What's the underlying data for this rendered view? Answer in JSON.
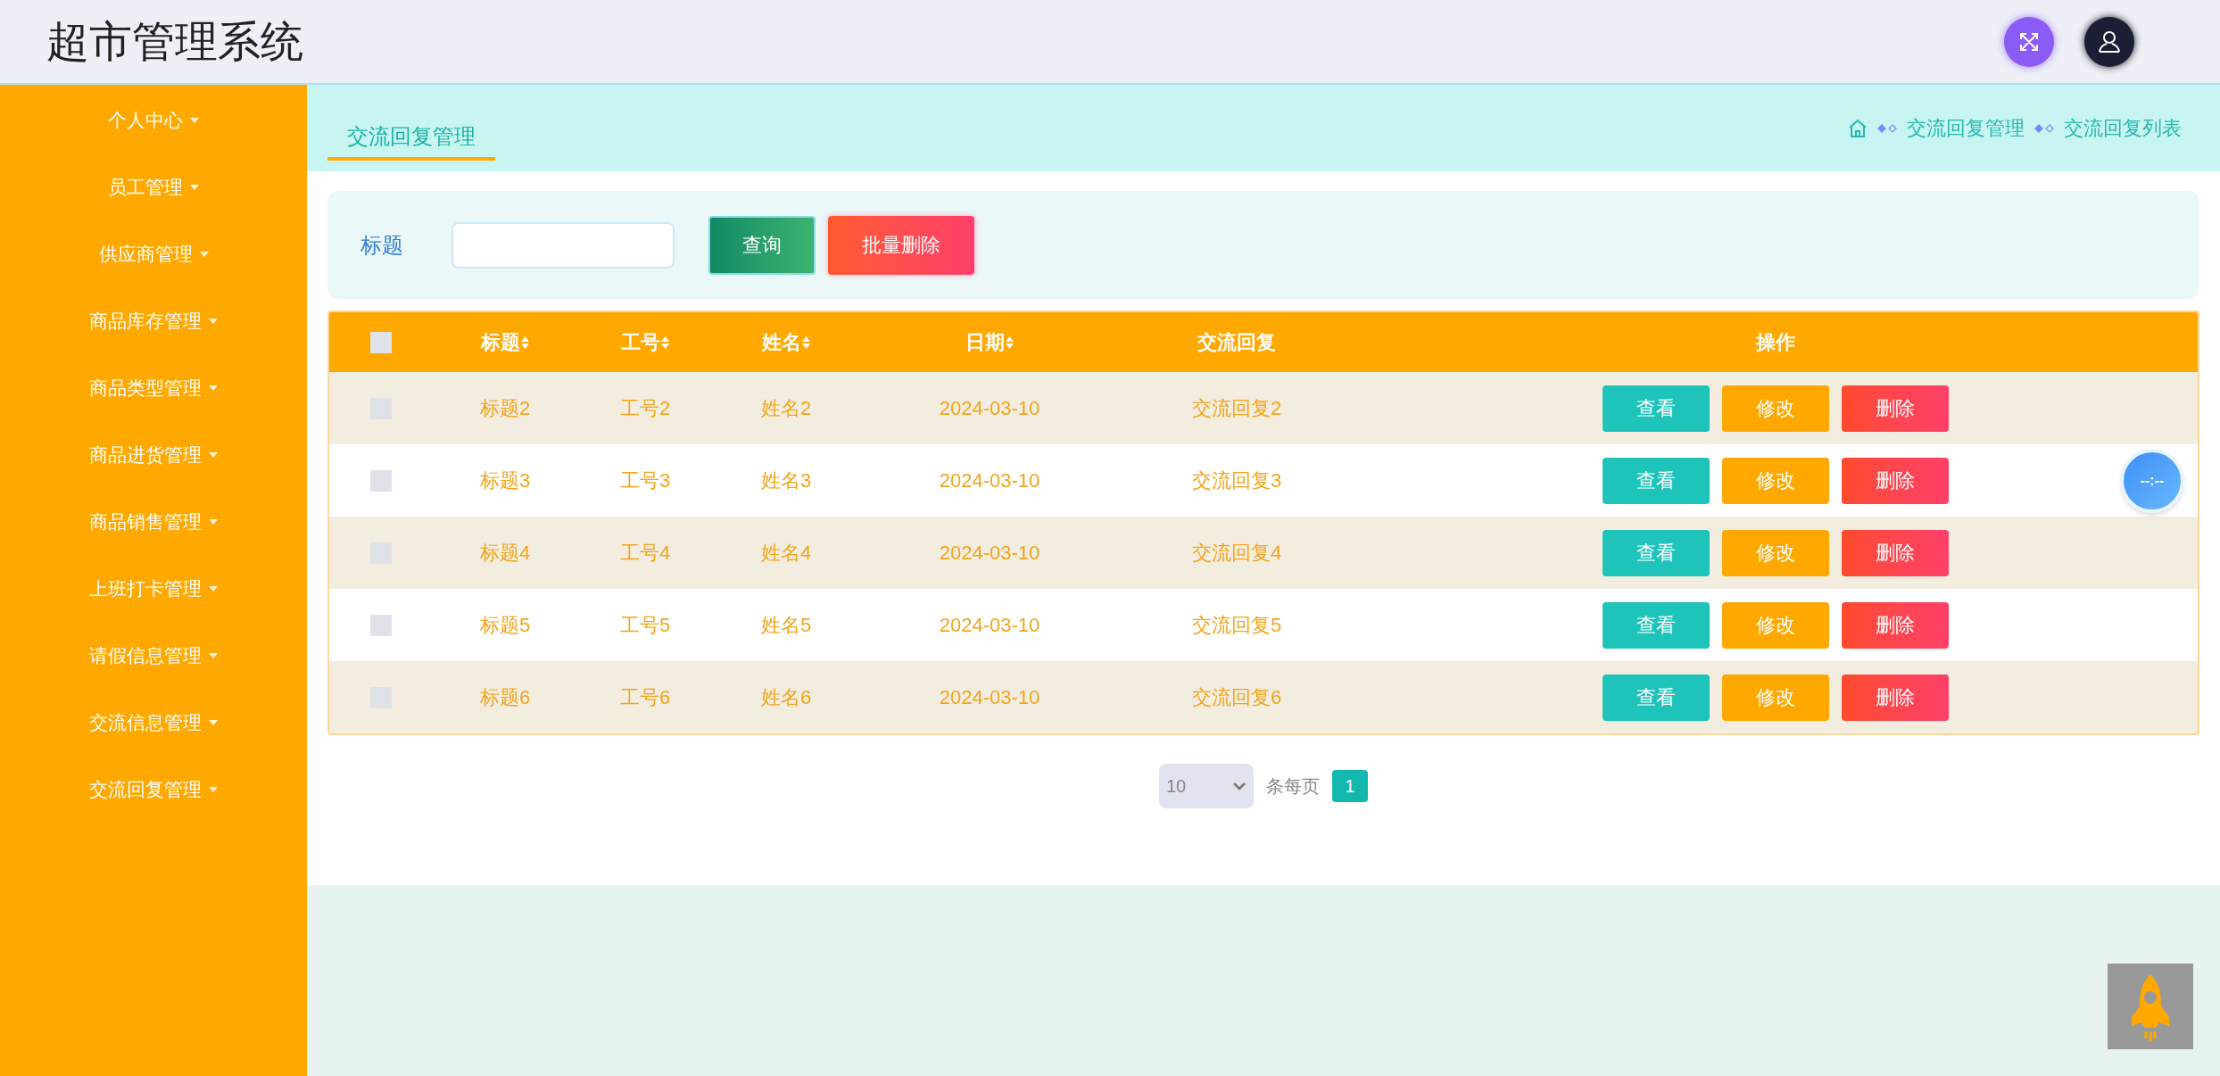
{
  "app_title": "超市管理系统",
  "sidebar": {
    "items": [
      {
        "label": "个人中心"
      },
      {
        "label": "员工管理"
      },
      {
        "label": "供应商管理"
      },
      {
        "label": "商品库存管理"
      },
      {
        "label": "商品类型管理"
      },
      {
        "label": "商品进货管理"
      },
      {
        "label": "商品销售管理"
      },
      {
        "label": "上班打卡管理"
      },
      {
        "label": "请假信息管理"
      },
      {
        "label": "交流信息管理"
      },
      {
        "label": "交流回复管理"
      }
    ]
  },
  "tab": {
    "label": "交流回复管理",
    "selected": true
  },
  "breadcrumb": [
    "交流回复管理",
    "交流回复列表"
  ],
  "search": {
    "label": "标题",
    "buttons": [
      {
        "label": "查询",
        "kind": "search"
      },
      {
        "label": "批量删除",
        "kind": "delete"
      }
    ]
  },
  "table": {
    "select_all_checked": false,
    "columns": [
      {
        "label": "标题",
        "sortable": true
      },
      {
        "label": "工号",
        "sortable": true
      },
      {
        "label": "姓名",
        "sortable": true
      },
      {
        "label": "日期",
        "sortable": true
      },
      {
        "label": "交流回复",
        "sortable": false
      },
      {
        "label": "操作",
        "sortable": false
      }
    ],
    "rows": [
      {
        "checked": false,
        "cells": [
          "标题2",
          "工号2",
          "姓名2",
          "2024-03-10",
          "交流回复2"
        ],
        "actions": [
          {
            "label": "查看",
            "kind": "view"
          },
          {
            "label": "修改",
            "kind": "edit"
          },
          {
            "label": "删除",
            "kind": "delete"
          }
        ]
      },
      {
        "checked": false,
        "cells": [
          "标题3",
          "工号3",
          "姓名3",
          "2024-03-10",
          "交流回复3"
        ],
        "actions": [
          {
            "label": "查看",
            "kind": "view"
          },
          {
            "label": "修改",
            "kind": "edit"
          },
          {
            "label": "删除",
            "kind": "delete"
          }
        ]
      },
      {
        "checked": false,
        "cells": [
          "标题4",
          "工号4",
          "姓名4",
          "2024-03-10",
          "交流回复4"
        ],
        "actions": [
          {
            "label": "查看",
            "kind": "view"
          },
          {
            "label": "修改",
            "kind": "edit"
          },
          {
            "label": "删除",
            "kind": "delete"
          }
        ]
      },
      {
        "checked": false,
        "cells": [
          "标题5",
          "工号5",
          "姓名5",
          "2024-03-10",
          "交流回复5"
        ],
        "actions": [
          {
            "label": "查看",
            "kind": "view"
          },
          {
            "label": "修改",
            "kind": "edit"
          },
          {
            "label": "删除",
            "kind": "delete"
          }
        ]
      },
      {
        "checked": false,
        "cells": [
          "标题6",
          "工号6",
          "姓名6",
          "2024-03-10",
          "交流回复6"
        ],
        "actions": [
          {
            "label": "查看",
            "kind": "view"
          },
          {
            "label": "修改",
            "kind": "edit"
          },
          {
            "label": "删除",
            "kind": "delete"
          }
        ]
      }
    ]
  },
  "pagination": {
    "page_size": "10",
    "page_size_label": "条每页",
    "pages": [
      {
        "label": "1",
        "selected": true
      }
    ]
  },
  "clock": "--:--"
}
